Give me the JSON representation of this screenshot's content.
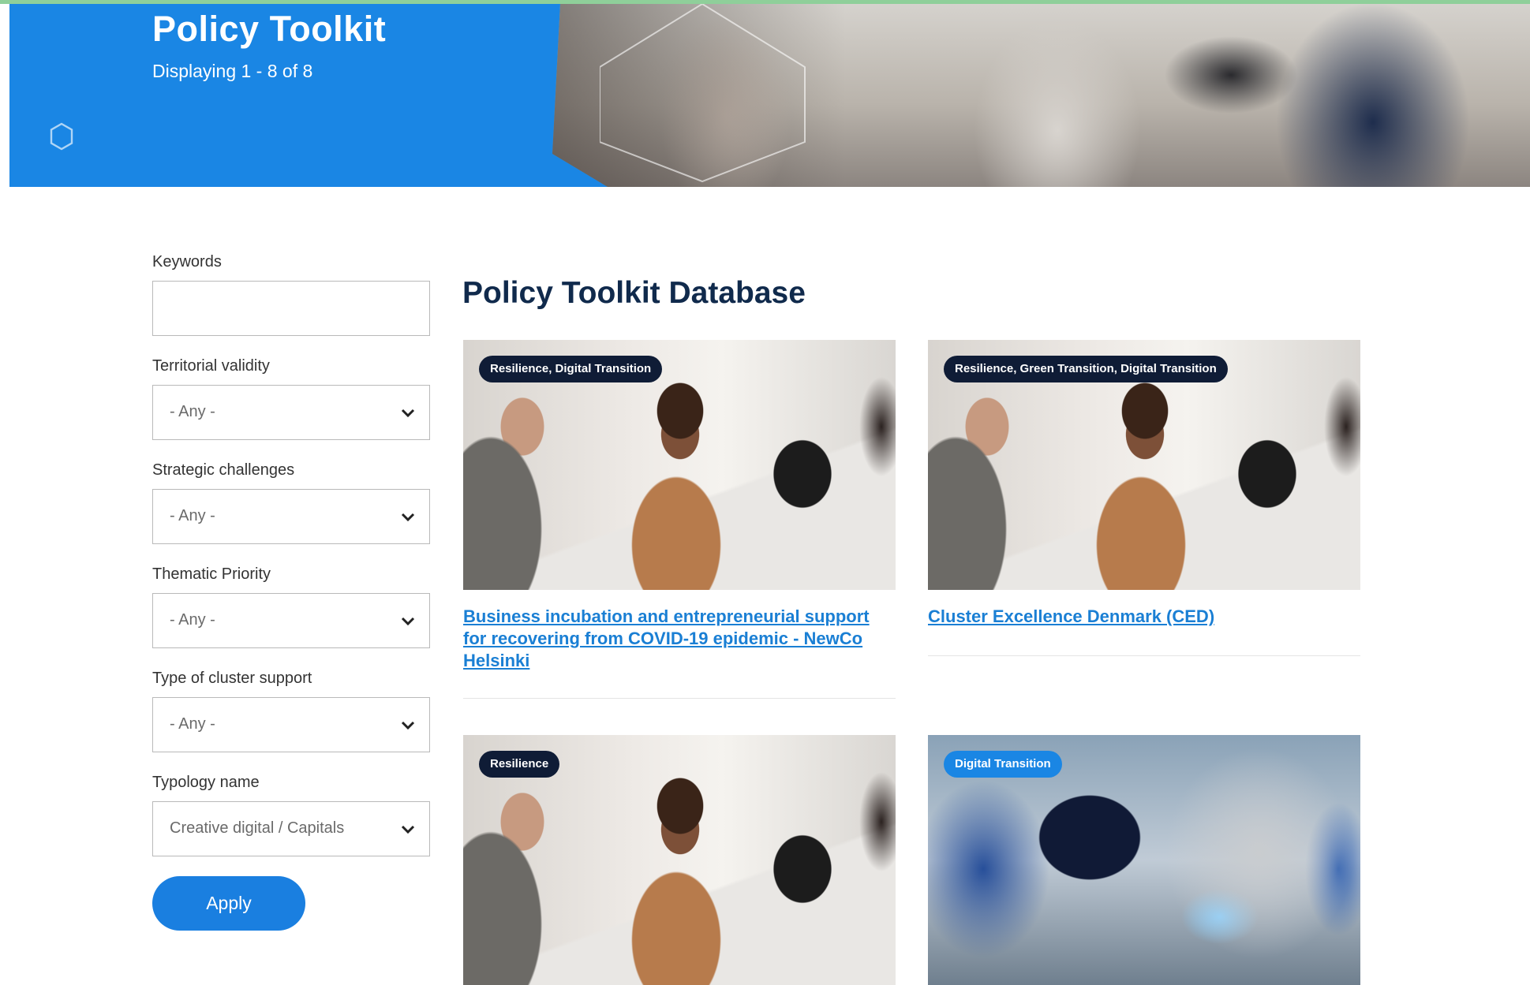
{
  "colors": {
    "primary": "#1a86e4",
    "heading": "#102a4c",
    "link": "#1a7fd4",
    "tag_dark": "#0f1c36"
  },
  "header": {
    "title": "Policy Toolkit",
    "subtitle": "Displaying 1 - 8 of 8",
    "icon": "hexagon-icon"
  },
  "filters": {
    "keywords": {
      "label": "Keywords",
      "value": ""
    },
    "territorial": {
      "label": "Territorial validity",
      "value": "- Any -"
    },
    "strategic": {
      "label": "Strategic challenges",
      "value": "- Any -"
    },
    "thematic": {
      "label": "Thematic Priority",
      "value": "- Any -"
    },
    "cluster": {
      "label": "Type of cluster support",
      "value": "- Any -"
    },
    "typology": {
      "label": "Typology name",
      "value": "Creative digital / Capitals"
    },
    "apply_label": "Apply"
  },
  "main": {
    "title": "Policy Toolkit Database",
    "cards": [
      {
        "tag": "Resilience, Digital Transition",
        "title": "Business incubation and entrepreneurial support for recovering from COVID-19 epidemic - NewCo Helsinki",
        "image": "office-meeting-photo"
      },
      {
        "tag": "Resilience, Green Transition, Digital Transition",
        "title": "Cluster Excellence Denmark (CED)",
        "image": "office-meeting-photo"
      },
      {
        "tag": "Resilience",
        "title": "",
        "image": "office-meeting-photo"
      },
      {
        "tag": "Digital Transition",
        "title": "",
        "image": "robotics-tablet-photo"
      }
    ]
  }
}
